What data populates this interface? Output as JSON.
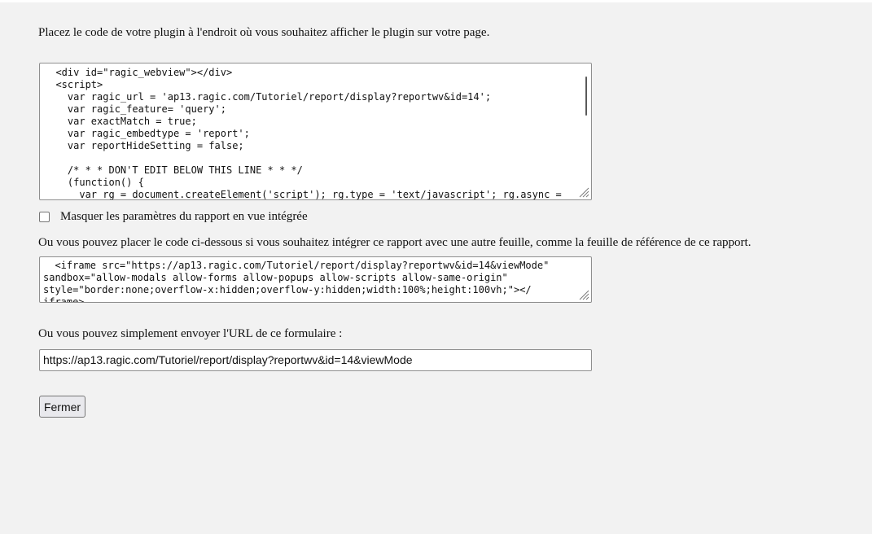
{
  "intro_text": "Placez le code de votre plugin à l'endroit où vous souhaitez afficher le plugin sur votre page.",
  "plugin_code": "  <div id=\"ragic_webview\"></div>\n  <script>\n    var ragic_url = 'ap13.ragic.com/Tutoriel/report/display?reportwv&id=14';\n    var ragic_feature= 'query';\n    var exactMatch = true;\n    var ragic_embedtype = 'report';\n    var reportHideSetting = false;\n\n    /* * * DON'T EDIT BELOW THIS LINE * * */\n    (function() {\n      var rg = document.createElement('script'); rg.type = 'text/javascript'; rg.async =",
  "hide_settings": {
    "label": "Masquer les paramètres du rapport en vue intégrée",
    "checked": false
  },
  "iframe_intro": "Ou vous pouvez placer le code ci-dessous si vous souhaitez intégrer ce rapport avec une autre feuille, comme la feuille de référence de ce rapport.",
  "iframe_code": "  <iframe src=\"https://ap13.ragic.com/Tutoriel/report/display?reportwv&id=14&viewMode\"\nsandbox=\"allow-modals allow-forms allow-popups allow-scripts allow-same-origin\"\nstyle=\"border:none;overflow-x:hidden;overflow-y:hidden;width:100%;height:100vh;\"></\niframe>",
  "url_intro": "Ou vous pouvez simplement envoyer l'URL de ce formulaire :",
  "url_value": "https://ap13.ragic.com/Tutoriel/report/display?reportwv&id=14&viewMode",
  "close_label": "Fermer"
}
